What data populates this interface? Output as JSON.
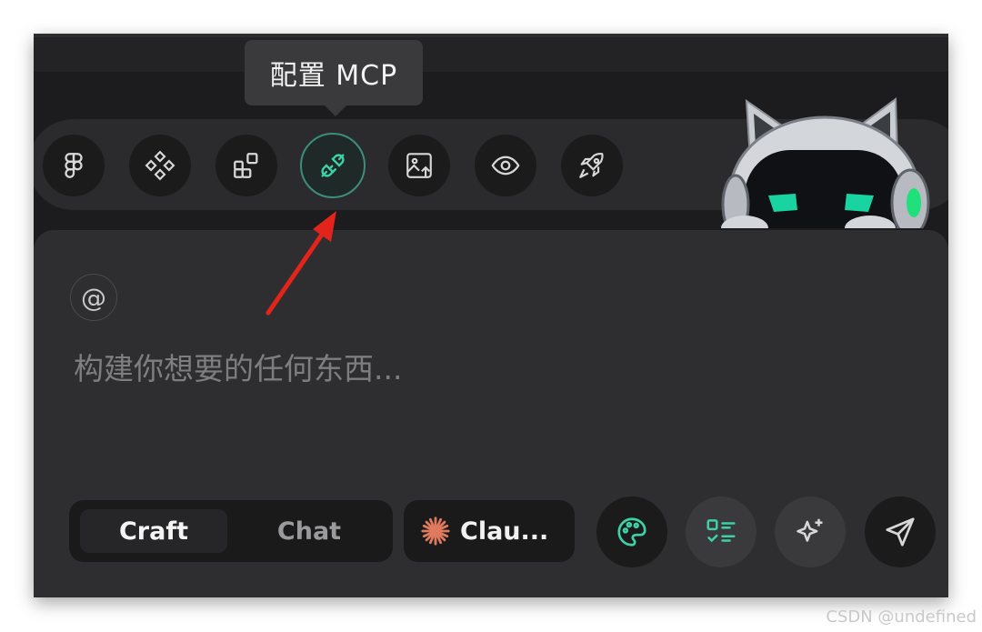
{
  "tooltip": {
    "text": "配置 MCP"
  },
  "toolbar": {
    "items": [
      {
        "name": "figma",
        "icon": "figma-icon"
      },
      {
        "name": "components",
        "icon": "components-icon"
      },
      {
        "name": "apps",
        "icon": "apps-grid-icon"
      },
      {
        "name": "mcp",
        "icon": "plug-icon",
        "active": true
      },
      {
        "name": "image-upload",
        "icon": "image-upload-icon"
      },
      {
        "name": "preview",
        "icon": "eye-icon"
      },
      {
        "name": "deploy",
        "icon": "rocket-icon"
      }
    ]
  },
  "input": {
    "mention_symbol": "@",
    "placeholder": "构建你想要的任何东西..."
  },
  "mode_toggle": {
    "craft_label": "Craft",
    "chat_label": "Chat",
    "selected": "Craft"
  },
  "model": {
    "label": "Clau...",
    "icon": "claude-burst-icon"
  },
  "actions": [
    {
      "name": "palette",
      "icon": "palette-icon"
    },
    {
      "name": "checklist",
      "icon": "checklist-icon"
    },
    {
      "name": "enhance",
      "icon": "sparkles-icon"
    },
    {
      "name": "send",
      "icon": "send-icon"
    }
  ],
  "colors": {
    "accent": "#3fd0a7",
    "claude_orange": "#e07a5f",
    "annotation_red": "#e3241b"
  },
  "watermark": "CSDN @undefined"
}
